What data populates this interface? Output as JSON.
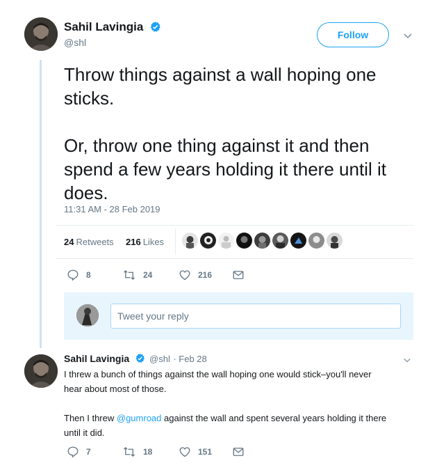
{
  "colors": {
    "accent": "#1da1f2",
    "text": "#14171a",
    "muted": "#657786",
    "reply_bg": "#e8f5fd",
    "thread_line": "#cfe3f3"
  },
  "main_tweet": {
    "author_name": "Sahil Lavingia",
    "author_handle": "@shl",
    "follow_label": "Follow",
    "text": "Throw things against a wall hoping one\nsticks.\n\nOr, throw one thing against it and then\nspend a few years holding it there until it\ndoes.",
    "timestamp": "11:31 AM - 28 Feb 2019",
    "retweets_count": "24",
    "retweets_label": "Retweets",
    "likes_count": "216",
    "likes_label": "Likes",
    "actions": {
      "replies": "8",
      "retweets": "24",
      "likes": "216"
    }
  },
  "reply_composer": {
    "placeholder": "Tweet your reply"
  },
  "reply_tweet": {
    "author_name": "Sahil Lavingia",
    "author_handle": "@shl",
    "date": "Feb 28",
    "text_part1": "I threw a bunch of things against the wall hoping one would stick–you'll never\nhear about most of those.\n\nThen I threw ",
    "mention": "@gumroad",
    "text_part2": " against the wall and spent several years holding it there\nuntil it did.",
    "actions": {
      "replies": "7",
      "retweets": "18",
      "likes": "151"
    }
  },
  "icons": [
    "verified-badge-icon",
    "chevron-down-icon",
    "reply-icon",
    "retweet-icon",
    "heart-icon",
    "envelope-icon"
  ]
}
